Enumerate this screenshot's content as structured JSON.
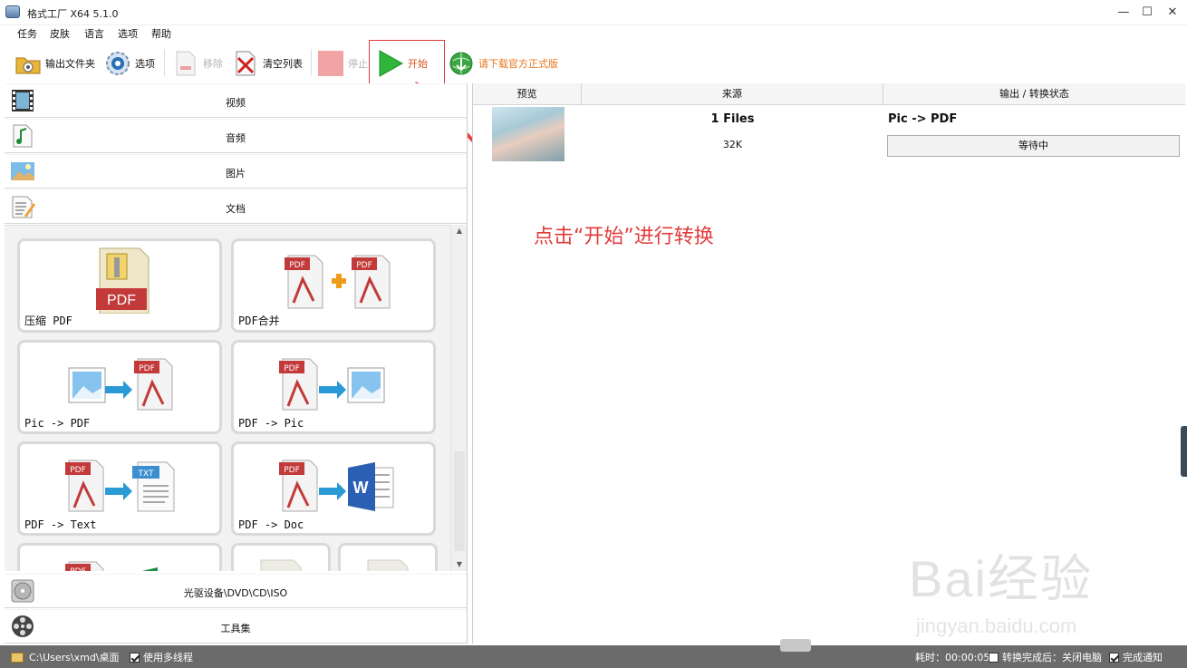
{
  "window": {
    "title": "格式工厂 X64 5.1.0",
    "controls": [
      "—",
      "☐",
      "✕"
    ]
  },
  "menu": [
    "任务",
    "皮肤",
    "语言",
    "选项",
    "帮助"
  ],
  "toolbar": {
    "output_folder": "输出文件夹",
    "options": "选项",
    "remove": "移除",
    "clear_list": "清空列表",
    "stop": "停止",
    "start": "开始",
    "download": "请下载官方正式版",
    "download_color": "#e8741a"
  },
  "categories": {
    "video": "视频",
    "audio": "音频",
    "image": "图片",
    "document": "文档",
    "optical": "光驱设备\\DVD\\CD\\ISO",
    "tools": "工具集"
  },
  "tiles": {
    "compress_pdf": "压缩 PDF",
    "pdf_merge": "PDF合并",
    "pic_to_pdf": "Pic -> PDF",
    "pdf_to_pic": "PDF -> Pic",
    "pdf_to_text": "PDF -> Text",
    "pdf_to_doc": "PDF -> Doc",
    "pdf_badge": "PDF",
    "txt_badge": "TXT",
    "word_badge": "W"
  },
  "grid": {
    "headers": [
      "预览",
      "来源",
      "输出 / 转换状态"
    ],
    "row": {
      "files": "1 Files",
      "size": "32K",
      "output": "Pic -> PDF",
      "status": "等待中"
    }
  },
  "annotation": {
    "text": "点击“开始”进行转换",
    "color": "#e23b3b"
  },
  "watermark": {
    "logo": "Bai经验",
    "url": "jingyan.baidu.com"
  },
  "statusbar": {
    "path": "C:\\Users\\xmd\\桌面",
    "multithread": "使用多线程",
    "elapsed": "耗时：00:00:05",
    "after_done": "转换完成后：关闭电脑",
    "notify": "完成通知"
  }
}
